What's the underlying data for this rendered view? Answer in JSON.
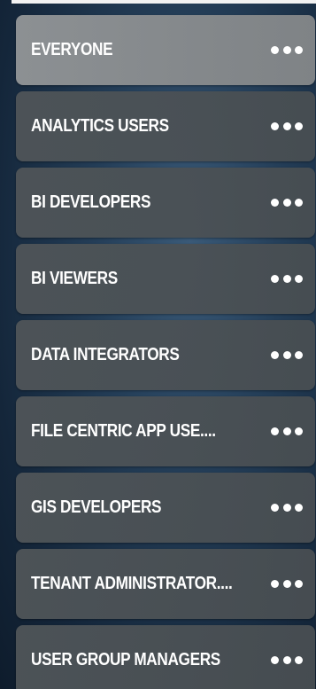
{
  "groups": [
    {
      "label": "EVERYONE"
    },
    {
      "label": "ANALYTICS USERS"
    },
    {
      "label": "BI DEVELOPERS"
    },
    {
      "label": "BI VIEWERS"
    },
    {
      "label": "DATA INTEGRATORS"
    },
    {
      "label": "FILE CENTRIC APP USE...."
    },
    {
      "label": "GIS DEVELOPERS"
    },
    {
      "label": "TENANT ADMINISTRATOR...."
    },
    {
      "label": "USER GROUP MANAGERS"
    }
  ],
  "more_icon": "more-horizontal-icon",
  "colors": {
    "active_item": "#8c9093",
    "item": "#4e5458",
    "text": "#ffffff"
  }
}
